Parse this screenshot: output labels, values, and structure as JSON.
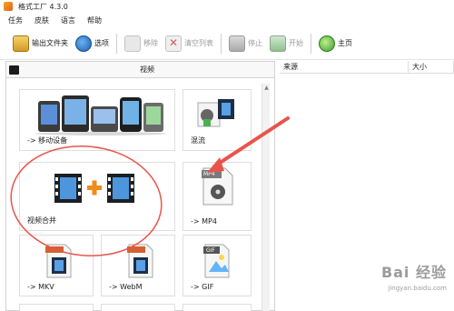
{
  "window": {
    "title": "格式工厂 4.3.0"
  },
  "menu": [
    "任务",
    "皮肤",
    "语言",
    "帮助"
  ],
  "toolbar": {
    "output_folder": "输出文件夹",
    "options": "选项",
    "remove": "移除",
    "clear_list": "清空列表",
    "stop": "停止",
    "start": "开始",
    "home": "主页"
  },
  "left_panel": {
    "header": "视频",
    "tiles": [
      {
        "label": "-> 移动设备"
      },
      {
        "label": "混流"
      },
      {
        "label": "视频合并"
      },
      {
        "label": "-> MP4",
        "badge": "MP4"
      },
      {
        "label": "-> MKV"
      },
      {
        "label": "-> WebM"
      },
      {
        "label": "-> GIF",
        "badge": "GIF"
      }
    ]
  },
  "right_panel": {
    "columns": [
      "来源",
      "大小"
    ]
  },
  "watermark": {
    "line1": "Bai  经验",
    "line2": "jingyan.baidu.com"
  },
  "colors": {
    "annotation": "#e8544c"
  }
}
